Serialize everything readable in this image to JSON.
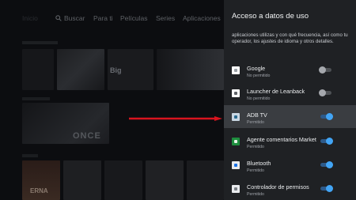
{
  "background": {
    "nav": {
      "hidden_first": "Inicio",
      "search": "Buscar",
      "for_you": "Para ti",
      "movies": "Películas",
      "series": "Series",
      "apps": "Aplicaciones"
    },
    "thumb_big": "Big",
    "thumb_once": "ONCE",
    "thumb_erna": "ERNA"
  },
  "panel": {
    "title": "Acceso a datos de uso",
    "description": "aplicaciones utilizas y con qué frecuencia, así como tu operador, los ajustes de idioma y otros detalles.",
    "items": [
      {
        "name": "Google",
        "status": "No permitido",
        "enabled": false,
        "icon": "google-app-icon",
        "focused": false
      },
      {
        "name": "Launcher de Leanback",
        "status": "No permitido",
        "enabled": false,
        "icon": "leanback-launcher-icon",
        "focused": false
      },
      {
        "name": "ADB TV",
        "status": "Permitido",
        "enabled": true,
        "icon": "adb-tv-icon",
        "focused": true
      },
      {
        "name": "Agente comentarios Market",
        "status": "Permitido",
        "enabled": true,
        "icon": "market-feedback-icon",
        "focused": false
      },
      {
        "name": "Bluetooth",
        "status": "Permitido",
        "enabled": true,
        "icon": "bluetooth-app-icon",
        "focused": false
      },
      {
        "name": "Controlador de permisos",
        "status": "Permitido",
        "enabled": true,
        "icon": "permission-controller-icon",
        "focused": false
      }
    ]
  },
  "colors": {
    "arrow": "#d9141e",
    "panel_bg": "#1f2124",
    "focused_row": "#3a3d41",
    "toggle_on": "#42a5f5",
    "toggle_off": "#a5a8ad"
  }
}
